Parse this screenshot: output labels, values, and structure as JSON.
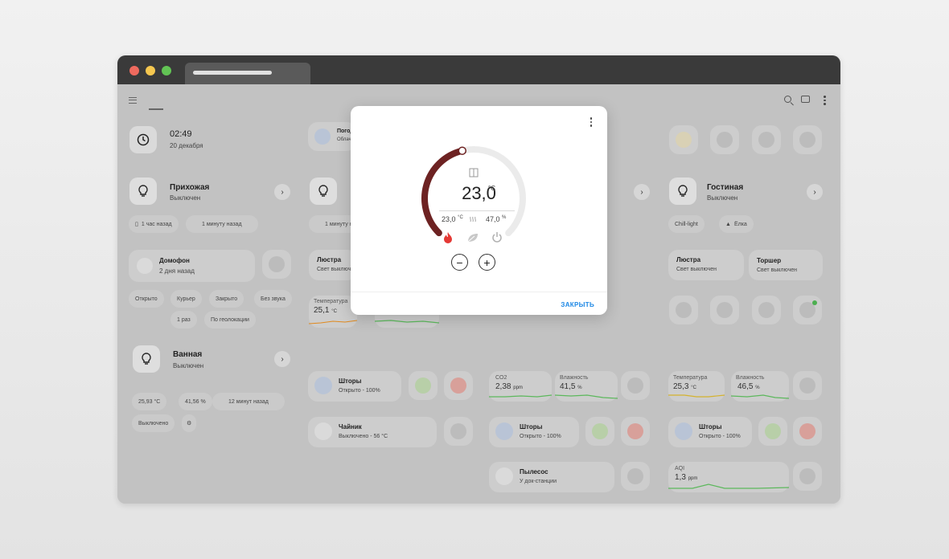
{
  "clock": {
    "time": "02:49",
    "date": "20 декабря"
  },
  "hallway": {
    "title": "Прихожая",
    "status": "Выключен",
    "chip1": "1 час назад",
    "chip2": "1 минуту назад"
  },
  "intercom": {
    "title": "Домофон",
    "status": "2 дня назад"
  },
  "intercom_chips": [
    "Открыто",
    "Курьер",
    "Закрыто",
    "Без звука",
    "1 раз",
    "По геолокации"
  ],
  "bathroom": {
    "title": "Ванная",
    "status": "Выключен",
    "temp": "25,93 °C",
    "humidity": "41,56 %",
    "updated": "12 минут назад",
    "mode": "Выключено"
  },
  "weather": {
    "title": "Погода",
    "sub": "Облачно"
  },
  "col2": {
    "chip": "1 минуту назад",
    "chandelier": {
      "title": "Люстра",
      "status": "Свет выключен"
    },
    "temp_label": "Температура",
    "temp_value": "25,1",
    "temp_unit": "°C",
    "curtains": {
      "title": "Шторы",
      "status": "Открыто - 100%"
    },
    "kettle": {
      "title": "Чайник",
      "status": "Выключено - 56 °C"
    }
  },
  "col3": {
    "co2_label": "CO2",
    "co2_value": "2,38",
    "co2_unit": "ppm",
    "hum_label": "Влажность",
    "hum_value": "41,5",
    "hum_unit": "%",
    "curtains": {
      "title": "Шторы",
      "status": "Открыто - 100%"
    },
    "vacuum": {
      "title": "Пылесос",
      "status": "У док-станции"
    }
  },
  "living": {
    "title": "Гостиная",
    "status": "Выключен",
    "chip1": "Chill-light",
    "chip2": "Ёлка",
    "chandelier": {
      "title": "Люстра",
      "status": "Свет выключен"
    },
    "floorlamp": {
      "title": "Торшер",
      "status": "Свет выключен"
    },
    "temp_label": "Температура",
    "temp_value": "25,3",
    "temp_unit": "°C",
    "hum_label": "Влажность",
    "hum_value": "46,5",
    "hum_unit": "%",
    "curtains": {
      "title": "Шторы",
      "status": "Открыто - 100%"
    },
    "aqi_label": "AQI",
    "aqi_value": "1,3",
    "aqi_unit": "ppm"
  },
  "thermostat": {
    "target": "23,0",
    "unit": "°C",
    "current": "23,0",
    "current_unit": "°C",
    "humidity": "47,0",
    "humidity_unit": "%",
    "setpoint_fraction": 0.45,
    "close_label": "ЗАКРЫТЬ",
    "accent": "#6d2222",
    "track": "#ebebeb",
    "heat_color": "#e53935"
  }
}
